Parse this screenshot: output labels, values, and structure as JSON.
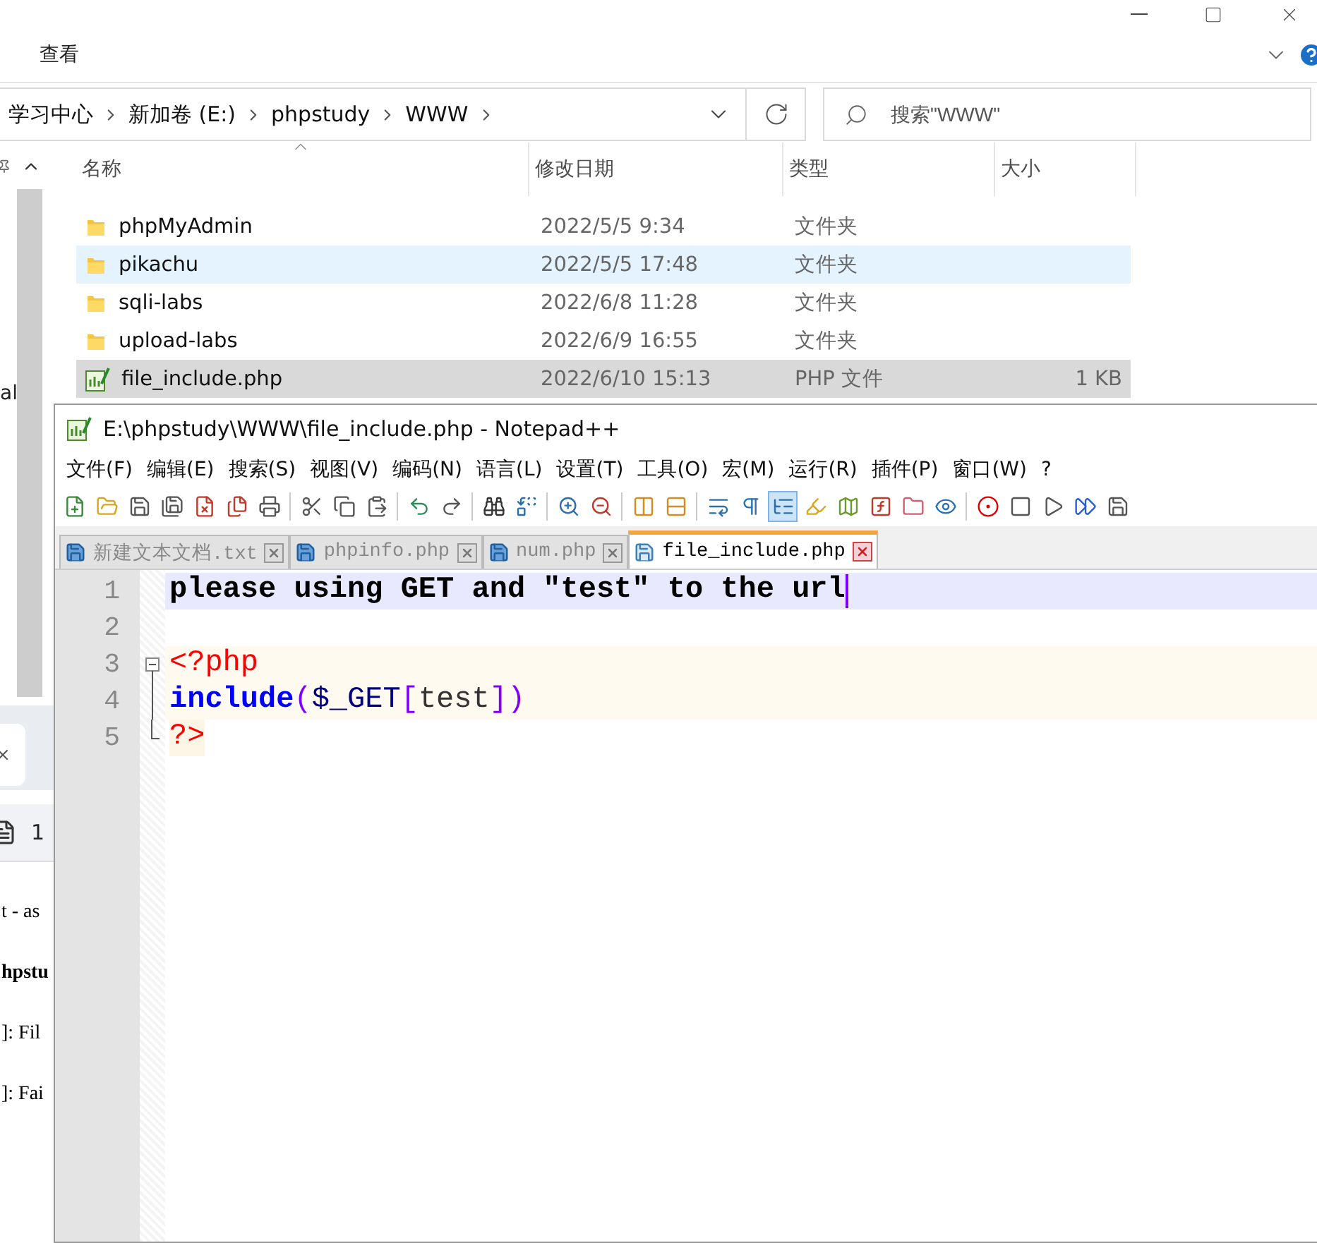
{
  "explorer": {
    "ribbon_tab": "查看",
    "breadcrumb": [
      "学习中心",
      "新加卷 (E:)",
      "phpstudy",
      "WWW"
    ],
    "search": {
      "placeholder": "搜索\"WWW\""
    },
    "nav_text": "al",
    "columns": [
      "名称",
      "修改日期",
      "类型",
      "大小"
    ],
    "rows": [
      {
        "kind": "folder",
        "name": "phpMyAdmin",
        "date": "2022/5/5 9:34",
        "type": "文件夹",
        "hovered": false,
        "selected": false
      },
      {
        "kind": "folder",
        "name": "pikachu",
        "date": "2022/5/5 17:48",
        "type": "文件夹",
        "hovered": true,
        "selected": false
      },
      {
        "kind": "folder",
        "name": "sqli-labs",
        "date": "2022/6/8 11:28",
        "type": "文件夹",
        "hovered": false,
        "selected": false
      },
      {
        "kind": "folder",
        "name": "upload-labs",
        "date": "2022/6/9 16:55",
        "type": "文件夹",
        "hovered": false,
        "selected": false
      },
      {
        "kind": "php",
        "name": "file_include.php",
        "date": "2022/6/10 15:13",
        "type": "PHP 文件",
        "size": "1 KB",
        "hovered": false,
        "selected": true
      }
    ]
  },
  "browser": {
    "tab_count": "1",
    "lines": [
      {
        "text": "t - as",
        "bold": false
      },
      {
        "text": "hpstu",
        "bold": true
      },
      {
        "text": "]: Fil",
        "bold": false
      },
      {
        "text": "]: Fai",
        "bold": false
      }
    ]
  },
  "notepad": {
    "title": "E:\\phpstudy\\WWW\\file_include.php - Notepad++",
    "menu": [
      "文件(F)",
      "编辑(E)",
      "搜索(S)",
      "视图(V)",
      "编码(N)",
      "语言(L)",
      "设置(T)",
      "工具(O)",
      "宏(M)",
      "运行(R)",
      "插件(P)",
      "窗口(W)",
      "?"
    ],
    "toolbar": [
      {
        "kind": "new",
        "pressed": false
      },
      {
        "kind": "open",
        "pressed": false
      },
      {
        "kind": "save",
        "pressed": false
      },
      {
        "kind": "save-all",
        "pressed": false
      },
      {
        "kind": "close",
        "pressed": false
      },
      {
        "kind": "close-all",
        "pressed": false
      },
      {
        "kind": "print",
        "pressed": false
      },
      {
        "kind": "cut",
        "pressed": false
      },
      {
        "kind": "copy",
        "pressed": false
      },
      {
        "kind": "paste",
        "pressed": false
      },
      {
        "kind": "undo",
        "pressed": false
      },
      {
        "kind": "redo",
        "pressed": false
      },
      {
        "kind": "find",
        "pressed": false
      },
      {
        "kind": "replace",
        "pressed": false
      },
      {
        "kind": "zoom-in",
        "pressed": false
      },
      {
        "kind": "zoom-out",
        "pressed": false
      },
      {
        "kind": "sync-v",
        "pressed": false
      },
      {
        "kind": "sync-h",
        "pressed": false
      },
      {
        "kind": "wrap",
        "pressed": false
      },
      {
        "kind": "all-chars",
        "pressed": false
      },
      {
        "kind": "indent-guide",
        "pressed": true
      },
      {
        "kind": "highlight",
        "pressed": false
      },
      {
        "kind": "doc-map",
        "pressed": false
      },
      {
        "kind": "function-list",
        "pressed": false
      },
      {
        "kind": "folder",
        "pressed": false
      },
      {
        "kind": "monitor",
        "pressed": false
      },
      {
        "kind": "record",
        "pressed": false
      },
      {
        "kind": "stop",
        "pressed": false
      },
      {
        "kind": "play",
        "pressed": false
      },
      {
        "kind": "play-multi",
        "pressed": false
      },
      {
        "kind": "save-macro",
        "pressed": false
      }
    ],
    "tabs": [
      {
        "label": "新建文本文档.txt",
        "selected": false
      },
      {
        "label": "phpinfo.php",
        "selected": false
      },
      {
        "label": "num.php",
        "selected": false
      },
      {
        "label": "file_include.php",
        "selected": true
      }
    ],
    "lines": [
      {
        "number": "1",
        "kind": "text",
        "current": true,
        "tokens": [
          {
            "kind": "text",
            "text": "please using GET and \"test\" to the url"
          }
        ]
      },
      {
        "number": "2",
        "kind": "text",
        "current": false
      },
      {
        "number": "3",
        "kind": "php",
        "fold_start": true,
        "fold_end": false,
        "current": false,
        "tokens": [
          {
            "kind": "tag",
            "text": "<?php"
          }
        ]
      },
      {
        "number": "4",
        "kind": "php",
        "fold_start": false,
        "fold_end": false,
        "current": false,
        "tokens": [
          {
            "kind": "keyword",
            "text": "include"
          },
          {
            "kind": "operator",
            "text": "("
          },
          {
            "kind": "variable",
            "text": "$_GET"
          },
          {
            "kind": "operator",
            "text": "["
          },
          {
            "kind": "plain",
            "text": "test"
          },
          {
            "kind": "operator",
            "text": "])"
          }
        ]
      },
      {
        "number": "5",
        "kind": "php-end",
        "fold_start": false,
        "fold_end": true,
        "current": false,
        "tokens": [
          {
            "kind": "tag",
            "text": "?>"
          }
        ]
      }
    ]
  }
}
